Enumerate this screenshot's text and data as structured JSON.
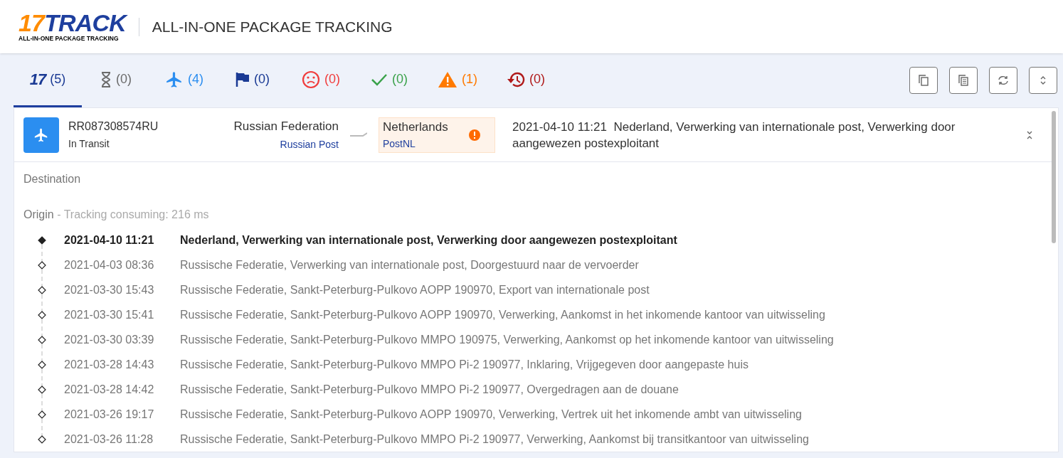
{
  "logo": {
    "number": "17",
    "word": "TRACK",
    "tagline": "ALL-IN-ONE PACKAGE TRACKING"
  },
  "header_title": "ALL-IN-ONE PACKAGE TRACKING",
  "tabs": [
    {
      "kind": "all",
      "icon_text": "17",
      "count": "(5)",
      "selected": true,
      "color": "#1a3a94"
    },
    {
      "kind": "pending",
      "count": "(0)",
      "selected": false,
      "color": "#6b6b6b"
    },
    {
      "kind": "transit",
      "count": "(4)",
      "selected": false,
      "color": "#2b8ef0"
    },
    {
      "kind": "pickup",
      "count": "(0)",
      "selected": false,
      "color": "#1a3a94"
    },
    {
      "kind": "undelivered",
      "count": "(0)",
      "selected": false,
      "color": "#f03c3c"
    },
    {
      "kind": "delivered",
      "count": "(0)",
      "selected": false,
      "color": "#3aa24a"
    },
    {
      "kind": "alert",
      "count": "(1)",
      "selected": false,
      "color": "#ff7a00"
    },
    {
      "kind": "expired",
      "count": "(0)",
      "selected": false,
      "color": "#b01a1a"
    }
  ],
  "toolbar": [
    {
      "kind": "copy"
    },
    {
      "kind": "copy-list"
    },
    {
      "kind": "refresh"
    },
    {
      "kind": "expand"
    }
  ],
  "shipment": {
    "number": "RR087308574RU",
    "status": "In Transit",
    "origin": {
      "country": "Russian Federation",
      "carrier": "Russian Post"
    },
    "destination": {
      "country": "Netherlands",
      "carrier": "PostNL",
      "alert": true
    },
    "latest_time": "2021-04-10 11:21",
    "latest_event": "Nederland, Verwerking van internationale post, Verwerking door aangewezen postexploitant",
    "destination_label": "Destination",
    "origin_label": "Origin",
    "consuming": "- Tracking consuming: 216 ms",
    "events": [
      {
        "time": "2021-04-10 11:21",
        "text": "Nederland, Verwerking van internationale post, Verwerking door aangewezen postexploitant",
        "selected": true
      },
      {
        "time": "2021-04-03 08:36",
        "text": "Russische Federatie, Verwerking van internationale post, Doorgestuurd naar de vervoerder",
        "selected": false
      },
      {
        "time": "2021-03-30 15:43",
        "text": "Russische Federatie, Sankt-Peterburg-Pulkovo AOPP 190970, Export van internationale post",
        "selected": false
      },
      {
        "time": "2021-03-30 15:41",
        "text": "Russische Federatie, Sankt-Peterburg-Pulkovo AOPP 190970, Verwerking, Aankomst in het inkomende kantoor van uitwisseling",
        "selected": false
      },
      {
        "time": "2021-03-30 03:39",
        "text": "Russische Federatie, Sankt-Peterburg-Pulkovo MMPO 190975, Verwerking, Aankomst op het inkomende kantoor van uitwisseling",
        "selected": false
      },
      {
        "time": "2021-03-28 14:43",
        "text": "Russische Federatie, Sankt-Peterburg-Pulkovo MMPO Pi-2 190977, Inklaring, Vrijgegeven door aangepaste huis",
        "selected": false
      },
      {
        "time": "2021-03-28 14:42",
        "text": "Russische Federatie, Sankt-Peterburg-Pulkovo MMPO Pi-2 190977, Overgedragen aan de douane",
        "selected": false
      },
      {
        "time": "2021-03-26 19:17",
        "text": "Russische Federatie, Sankt-Peterburg-Pulkovo AOPP 190970, Verwerking, Vertrek uit het inkomende ambt van uitwisseling",
        "selected": false
      },
      {
        "time": "2021-03-26 11:28",
        "text": "Russische Federatie, Sankt-Peterburg-Pulkovo MMPO Pi-2 190977, Verwerking, Aankomst bij transitkantoor van uitwisseling",
        "selected": false
      }
    ]
  }
}
